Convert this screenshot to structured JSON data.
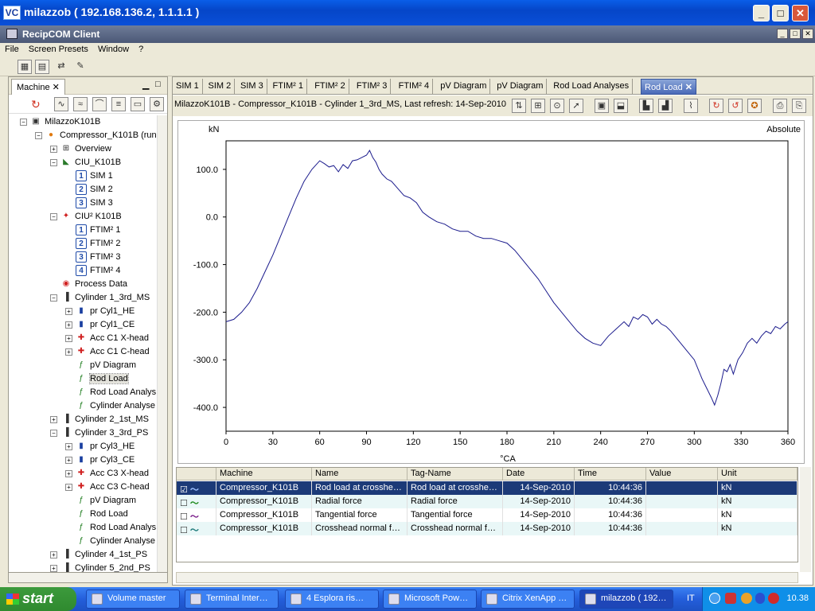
{
  "window": {
    "title": "milazzob ( 192.168.136.2, 1.1.1.1 )",
    "icon_text": "VC"
  },
  "app": {
    "title": "RecipCOM Client"
  },
  "menu": [
    "File",
    "Screen Presets",
    "Window",
    "?"
  ],
  "left_panel": {
    "tab_label": "Machine",
    "tree": [
      {
        "label": "MilazzoK101B",
        "level": 0,
        "exp": "−",
        "icon": "machine-icon"
      },
      {
        "label": "Compressor_K101B (run",
        "level": 1,
        "exp": "−",
        "icon": "compressor-icon"
      },
      {
        "label": "Overview",
        "level": 2,
        "exp": "+",
        "icon": "overview-icon"
      },
      {
        "label": "CIU_K101B",
        "level": 2,
        "exp": "−",
        "icon": "ciu-icon"
      },
      {
        "label": "SIM 1",
        "level": 3,
        "exp": "",
        "icon": "num-1-icon",
        "num": "1"
      },
      {
        "label": "SIM 2",
        "level": 3,
        "exp": "",
        "icon": "num-2-icon",
        "num": "2"
      },
      {
        "label": "SIM 3",
        "level": 3,
        "exp": "",
        "icon": "num-3-icon",
        "num": "3"
      },
      {
        "label": "CIU² K101B",
        "level": 2,
        "exp": "−",
        "icon": "ciu2-icon"
      },
      {
        "label": "FTIM² 1",
        "level": 3,
        "exp": "",
        "icon": "num-1-icon",
        "num": "1"
      },
      {
        "label": "FTIM² 2",
        "level": 3,
        "exp": "",
        "icon": "num-2-icon",
        "num": "2"
      },
      {
        "label": "FTIM² 3",
        "level": 3,
        "exp": "",
        "icon": "num-3-icon",
        "num": "3"
      },
      {
        "label": "FTIM² 4",
        "level": 3,
        "exp": "",
        "icon": "num-4-icon",
        "num": "4"
      },
      {
        "label": "Process Data",
        "level": 2,
        "exp": "",
        "icon": "process-data-icon"
      },
      {
        "label": "Cylinder 1_3rd_MS",
        "level": 2,
        "exp": "−",
        "icon": "cylinder-icon"
      },
      {
        "label": "pr Cyl1_HE",
        "level": 3,
        "exp": "+",
        "icon": "pressure-sensor-icon"
      },
      {
        "label": "pr Cyl1_CE",
        "level": 3,
        "exp": "+",
        "icon": "pressure-sensor-icon"
      },
      {
        "label": "Acc C1 X-head",
        "level": 3,
        "exp": "+",
        "icon": "accelerometer-icon"
      },
      {
        "label": "Acc C1 C-head",
        "level": 3,
        "exp": "+",
        "icon": "accelerometer-icon"
      },
      {
        "label": "pV Diagram",
        "level": 3,
        "exp": "",
        "icon": "function-icon"
      },
      {
        "label": "Rod Load",
        "level": 3,
        "exp": "",
        "icon": "function-icon",
        "selected": true
      },
      {
        "label": "Rod Load Analys",
        "level": 3,
        "exp": "",
        "icon": "function-icon"
      },
      {
        "label": "Cylinder Analyse",
        "level": 3,
        "exp": "",
        "icon": "function-icon"
      },
      {
        "label": "Cylinder 2_1st_MS",
        "level": 2,
        "exp": "+",
        "icon": "cylinder-icon"
      },
      {
        "label": "Cylinder 3_3rd_PS",
        "level": 2,
        "exp": "−",
        "icon": "cylinder-icon"
      },
      {
        "label": "pr Cyl3_HE",
        "level": 3,
        "exp": "+",
        "icon": "pressure-sensor-icon"
      },
      {
        "label": "pr Cyl3_CE",
        "level": 3,
        "exp": "+",
        "icon": "pressure-sensor-icon"
      },
      {
        "label": "Acc C3 X-head",
        "level": 3,
        "exp": "+",
        "icon": "accelerometer-icon"
      },
      {
        "label": "Acc C3 C-head",
        "level": 3,
        "exp": "+",
        "icon": "accelerometer-icon"
      },
      {
        "label": "pV Diagram",
        "level": 3,
        "exp": "",
        "icon": "function-icon"
      },
      {
        "label": "Rod Load",
        "level": 3,
        "exp": "",
        "icon": "function-icon"
      },
      {
        "label": "Rod Load Analys",
        "level": 3,
        "exp": "",
        "icon": "function-icon"
      },
      {
        "label": "Cylinder Analyse",
        "level": 3,
        "exp": "",
        "icon": "function-icon"
      },
      {
        "label": "Cylinder 4_1st_PS",
        "level": 2,
        "exp": "+",
        "icon": "cylinder-icon"
      },
      {
        "label": "Cylinder 5_2nd_PS",
        "level": 2,
        "exp": "+",
        "icon": "cylinder-icon"
      }
    ]
  },
  "tabs": [
    "SIM 1",
    "SIM 2",
    "SIM 3",
    "FTIM² 1",
    "FTIM² 2",
    "FTIM² 3",
    "FTIM² 4",
    "pV Diagram",
    "pV Diagram",
    "Rod Load Analyses",
    "Rod Load"
  ],
  "active_tab": "Rod Load",
  "info": {
    "text": "MilazzoK101B  -  Compressor_K101B  -  Cylinder 1_3rd_MS,   Last refresh: 14-Sep-2010"
  },
  "chart_data": {
    "type": "line",
    "ylabel": "kN",
    "xlabel": "°CA",
    "corner_label": "Absolute",
    "xlim": [
      0,
      360
    ],
    "ylim": [
      -450,
      160
    ],
    "xticks": [
      0,
      30,
      60,
      90,
      120,
      150,
      180,
      210,
      240,
      270,
      300,
      330,
      360
    ],
    "yticks": [
      100.0,
      0.0,
      -100.0,
      -200.0,
      -300.0,
      -400.0
    ],
    "ytick_labels": [
      "100.0",
      "0.0",
      "-100.0",
      "-200.0",
      "-300.0",
      "-400.0"
    ],
    "color": "#1a1a8c",
    "series": [
      {
        "x": [
          0,
          5,
          10,
          15,
          20,
          25,
          30,
          35,
          40,
          45,
          50,
          55,
          60,
          63,
          66,
          69,
          72,
          75,
          78,
          81,
          84,
          87,
          90,
          92,
          94,
          96,
          98,
          100,
          103,
          106,
          110,
          114,
          118,
          122,
          126,
          130,
          135,
          140,
          145,
          150,
          155,
          160,
          165,
          170,
          175,
          180,
          185,
          190,
          195,
          200,
          205,
          210,
          215,
          220,
          225,
          230,
          235,
          240,
          245,
          250,
          255,
          258,
          261,
          264,
          267,
          270,
          273,
          276,
          279,
          282,
          285,
          290,
          295,
          300,
          305,
          308,
          311,
          313,
          315,
          317,
          319,
          321,
          323,
          325,
          328,
          331,
          334,
          337,
          340,
          343,
          346,
          349,
          352,
          355,
          358,
          360
        ],
        "y": [
          -220,
          -215,
          -200,
          -180,
          -150,
          -115,
          -80,
          -40,
          0,
          40,
          75,
          100,
          118,
          112,
          105,
          108,
          95,
          110,
          102,
          118,
          120,
          125,
          130,
          140,
          125,
          115,
          100,
          90,
          80,
          75,
          60,
          45,
          40,
          30,
          10,
          0,
          -10,
          -15,
          -25,
          -30,
          -30,
          -40,
          -45,
          -45,
          -50,
          -55,
          -70,
          -90,
          -110,
          -130,
          -155,
          -180,
          -200,
          -220,
          -240,
          -255,
          -265,
          -270,
          -250,
          -235,
          -220,
          -230,
          -210,
          -215,
          -205,
          -210,
          -225,
          -215,
          -225,
          -230,
          -240,
          -260,
          -280,
          -300,
          -340,
          -360,
          -380,
          -395,
          -375,
          -350,
          -320,
          -325,
          -310,
          -330,
          -300,
          -285,
          -265,
          -255,
          -265,
          -250,
          -240,
          -245,
          -230,
          -235,
          -225,
          -220
        ]
      }
    ]
  },
  "table": {
    "columns": [
      "Machine",
      "Name",
      "Tag-Name",
      "Date",
      "Time",
      "Value",
      "Unit"
    ],
    "rows": [
      {
        "checked": "☑",
        "color": "#1a3fa0",
        "machine": "Compressor_K101B",
        "name": "Rod load at crosshe…",
        "tag": "Rod load at crosshe…",
        "date": "14-Sep-2010",
        "time": "10:44:36",
        "value": "",
        "unit": "kN",
        "selected": true
      },
      {
        "checked": "☐",
        "color": "#1e8a1e",
        "machine": "Compressor_K101B",
        "name": "Radial force",
        "tag": "Radial force",
        "date": "14-Sep-2010",
        "time": "10:44:36",
        "value": "",
        "unit": "kN"
      },
      {
        "checked": "☐",
        "color": "#7a1e8a",
        "machine": "Compressor_K101B",
        "name": "Tangential force",
        "tag": "Tangential force",
        "date": "14-Sep-2010",
        "time": "10:44:36",
        "value": "",
        "unit": "kN"
      },
      {
        "checked": "☐",
        "color": "#1e7a7a",
        "machine": "Compressor_K101B",
        "name": "Crosshead normal f…",
        "tag": "Crosshead normal f…",
        "date": "14-Sep-2010",
        "time": "10:44:36",
        "value": "",
        "unit": "kN"
      }
    ]
  },
  "taskbar": {
    "start": "start",
    "items": [
      "Volume master",
      "Terminal Inter…",
      "4 Esplora ris…",
      "Microsoft Pow…",
      "Citrix XenApp …",
      "milazzob ( 192…"
    ],
    "lang": "IT",
    "clock": "10.38"
  }
}
